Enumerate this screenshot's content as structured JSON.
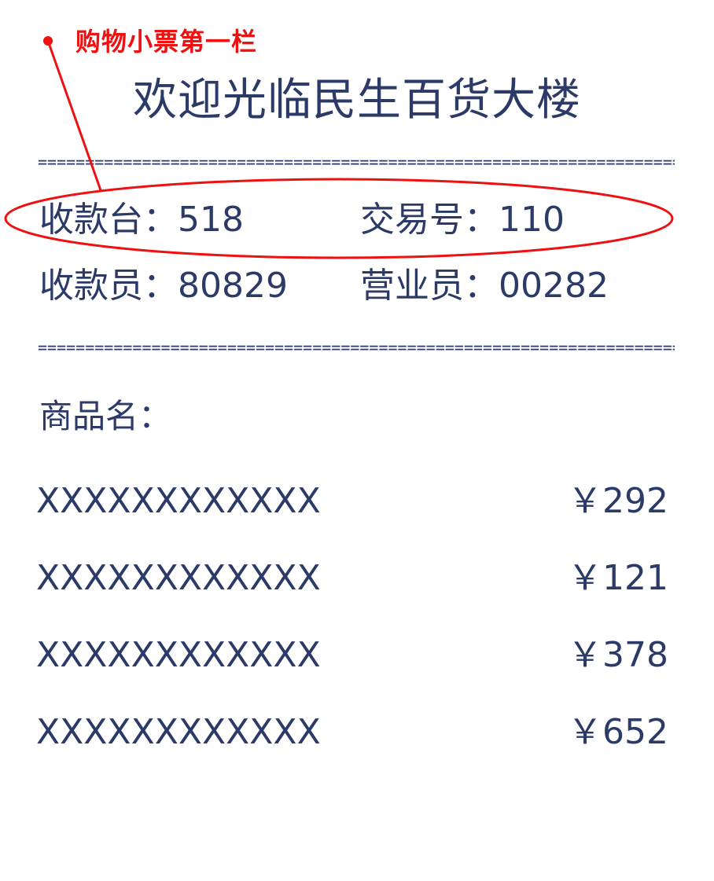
{
  "annotation": {
    "label": "购物小票第一栏",
    "color": "#ee1111"
  },
  "receipt": {
    "title": "欢迎光临民生百货大楼",
    "divider": "=====================================================================",
    "info": [
      {
        "left": "收款台：518",
        "right": "交易号：110"
      },
      {
        "left": "收款员：80829",
        "right": "营业员：00282"
      }
    ],
    "items_label": "商品名：",
    "items": [
      {
        "name": "XXXXXXXXXXXX",
        "price": "￥292"
      },
      {
        "name": "XXXXXXXXXXXX",
        "price": "￥121"
      },
      {
        "name": "XXXXXXXXXXXX",
        "price": "￥378"
      },
      {
        "name": "XXXXXXXXXXXX",
        "price": "￥652"
      }
    ],
    "text_color": "#2b3a67"
  }
}
